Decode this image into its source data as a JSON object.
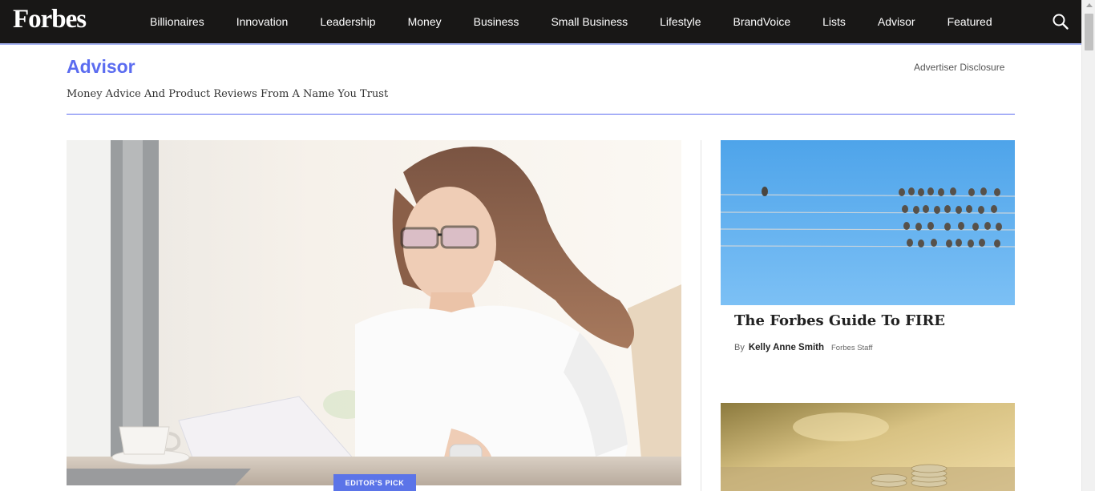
{
  "nav": {
    "logo": "Forbes",
    "items": [
      "Billionaires",
      "Innovation",
      "Leadership",
      "Money",
      "Business",
      "Small Business",
      "Lifestyle",
      "BrandVoice",
      "Lists",
      "Advisor",
      "Featured"
    ],
    "search_icon": "search-icon"
  },
  "header": {
    "title": "Advisor",
    "disclosure": "Advertiser Disclosure",
    "tagline": "Money Advice And Product Reviews From A Name You Trust"
  },
  "hero": {
    "image": "woman-reading-document-photo",
    "badge": "EDITOR'S PICK"
  },
  "cards": [
    {
      "image": "birds-on-wires-photo",
      "title": "The Forbes Guide To FIRE",
      "by": "By",
      "author": "Kelly Anne Smith",
      "author_role": "Forbes Staff"
    },
    {
      "image": "coin-stacks-photo"
    }
  ],
  "colors": {
    "nav_bg": "#181716",
    "accent": "#5b6cf0",
    "badge_bg": "#5b74e8"
  }
}
